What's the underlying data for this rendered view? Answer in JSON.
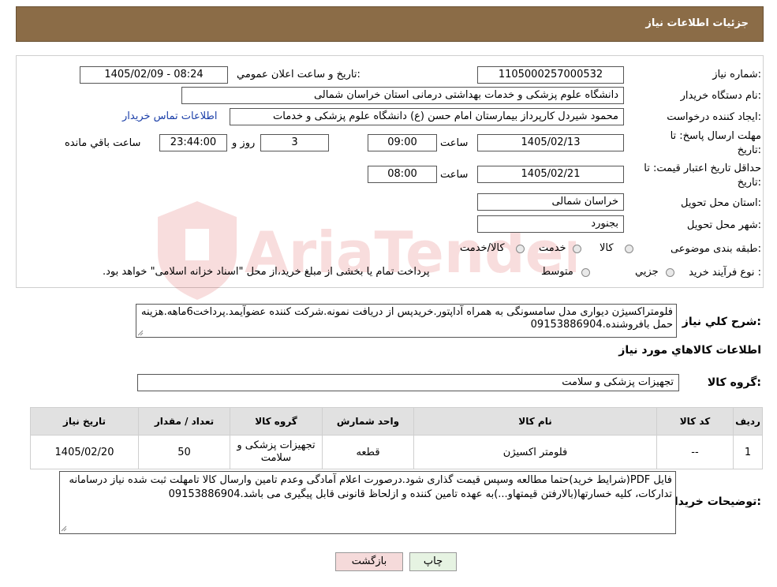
{
  "header": {
    "title": "جزئیات اطلاعات نیاز"
  },
  "watermark": {
    "text": "AriaTender.neT"
  },
  "form": {
    "need_number": {
      "label": "شماره نیاز:",
      "value": "1105000257000532"
    },
    "announce": {
      "label": "تاریخ و ساعت اعلان عمومي:",
      "value": "1405/02/09 - 08:24"
    },
    "buyer_org": {
      "label": "نام دستگاه خريدار:",
      "value": "دانشگاه علوم پزشکی و خدمات بهداشتی درمانی استان خراسان شمالی"
    },
    "requester": {
      "label": "ايجاد کننده درخواست:",
      "value": "محمود شیردل کارپرداز بیمارستان امام حسن (ع) دانشگاه علوم پزشکی و خدمات",
      "contact_link": "اطلاعات تماس خريدار"
    },
    "deadline": {
      "label_line1": "مهلت ارسال پاسخ: تا",
      "label_line2": "تاريخ:",
      "date": "1405/02/13",
      "time_label": "ساعت",
      "time": "09:00",
      "days": "3",
      "days_label": "روز و",
      "remaining": "23:44:00",
      "remaining_label": "ساعت باقي مانده"
    },
    "validity": {
      "label_line1": "حداقل تاريخ اعتبار قيمت: تا",
      "label_line2": "تاريخ:",
      "date": "1405/02/21",
      "time_label": "ساعت",
      "time": "08:00"
    },
    "province": {
      "label": "استان محل تحويل:",
      "value": "خراسان شمالی"
    },
    "city": {
      "label": "شهر محل تحويل:",
      "value": "بجنورد"
    },
    "category": {
      "label": "طبقه بندی موضوعی:",
      "options": [
        "کالا",
        "خدمت",
        "کالا/خدمت"
      ]
    },
    "process": {
      "label": "نوع فرآيند خريد :",
      "options": [
        "جزيي",
        "متوسط"
      ],
      "note": "پرداخت تمام یا بخشی از مبلغ خرید،از محل \"اسناد خزانه اسلامی\" خواهد بود."
    }
  },
  "summary": {
    "label": "شرح کلي نياز:",
    "text": "فلومتراکسیژن دیواری مدل سامسونگی به همراه آداپتور.خریدپس از دریافت نمونه.شرکت کننده عضوآیمد.پرداخت6ماهه.هزینه حمل بافروشنده.09153886904"
  },
  "goods_info": {
    "title": "اطلاعات کالاهاي مورد نياز"
  },
  "goods_group": {
    "label": "گروه کالا:",
    "value": "تجهیزات پزشکی و سلامت"
  },
  "table": {
    "headers": [
      "رديف",
      "کد کالا",
      "نام کالا",
      "واحد شمارش",
      "گروه کالا",
      "تعداد / مقدار",
      "تاريخ نياز"
    ],
    "rows": [
      {
        "row": "1",
        "code": "--",
        "name": "فلومتر اکسیژن",
        "unit": "قطعه",
        "group": "تجهیزات پزشکی و سلامت",
        "qty": "50",
        "date": "1405/02/20"
      }
    ]
  },
  "buyer_notes": {
    "label": "توضيحات خريدار:",
    "text": "فایل PDF(شرایط خرید)حتما مطالعه وسپس قیمت گذاری شود.درصورت اعلام آمادگی وعدم تامین وارسال کالا تامهلت ثبت شده نیاز درسامانه تدارکات، کلیه خسارتها(بالارفتن قیمتهاو...)به عهده تامین کننده و ازلحاظ قانونی قابل پیگیری می باشد.09153886904"
  },
  "buttons": {
    "print": "چاپ",
    "back": "بازگشت"
  },
  "colors": {
    "header_bg": "#8b6c47",
    "table_header_bg": "#e1e1e1",
    "back_button_bg": "#f5dada",
    "print_button_bg": "#e6f3e2"
  }
}
